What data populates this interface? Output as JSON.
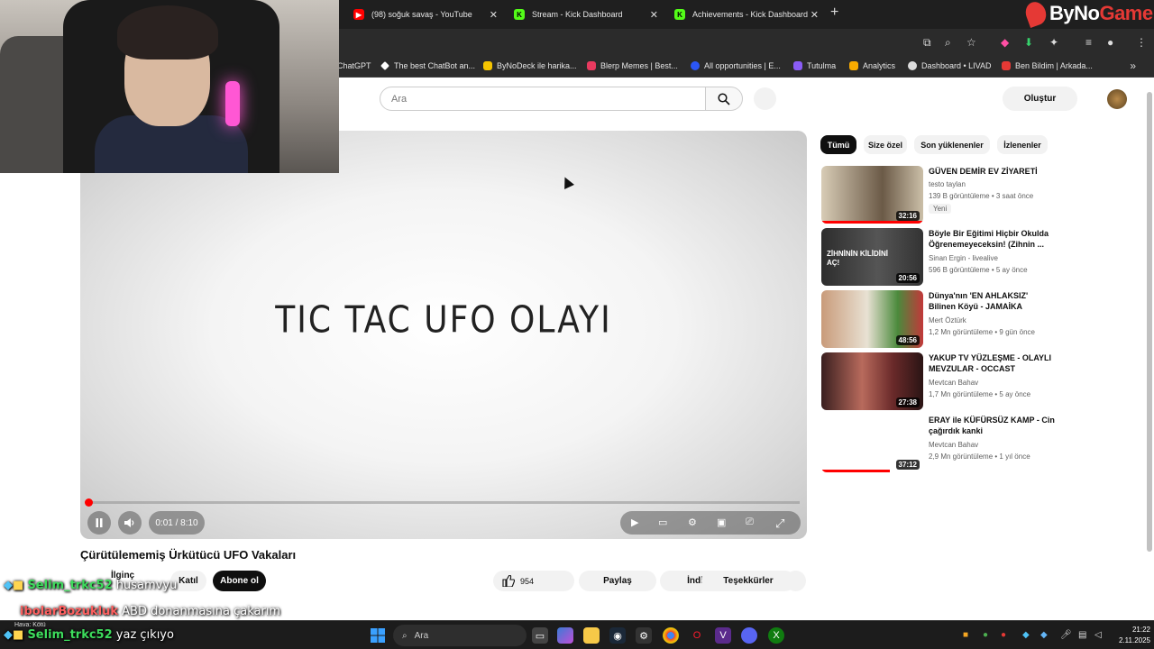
{
  "browser": {
    "tabs": [
      {
        "label": "(98) soğuk savaş - YouTube",
        "color": "#ff0000",
        "glyph": "▶"
      },
      {
        "label": "Stream - Kick Dashboard",
        "color": "#53fc18",
        "glyph": "K"
      },
      {
        "label": "Achievements - Kick Dashboard",
        "color": "#53fc18",
        "glyph": "K"
      }
    ],
    "new_tab": "+",
    "close_glyph": "✕",
    "bookmarks": [
      {
        "label": "ChatGPT",
        "color": "#2b2b2b"
      },
      {
        "label": "The best ChatBot an...",
        "color": "#ffffff"
      },
      {
        "label": "ByNoDeck ile harika...",
        "color": "#f5c400"
      },
      {
        "label": "Blerp Memes | Best...",
        "color": "#e83a5f"
      },
      {
        "label": "All opportunities | E...",
        "color": "#2b56f5"
      },
      {
        "label": "Tutulma",
        "color": "#8a5cf6"
      },
      {
        "label": "Analytics",
        "color": "#f9ab00"
      },
      {
        "label": "Dashboard • LIVAD",
        "color": "#dddddd"
      },
      {
        "label": "Ben Bildim | Arkada...",
        "color": "#e53935"
      }
    ],
    "more_bookmarks": "»"
  },
  "brand": {
    "name_a": "ByNo",
    "name_b": "Game"
  },
  "youtube": {
    "search_placeholder": "Ara",
    "create_label": "Oluştur",
    "video": {
      "overlay_title": "TIC TAC UFO OLAYI",
      "time": "0:01 / 8:10",
      "progress": 0.002,
      "title": "Çürütülememiş Ürkütücü UFO Vakaları",
      "channel": "İlginç",
      "join_label": "Katıl",
      "subscribe_label": "Abone ol",
      "likes": "954",
      "share_label": "Paylaş",
      "download_label": "İndir",
      "thanks_label": "Teşekkürler"
    },
    "chips": [
      "Tümü",
      "Size özel",
      "Son yüklenenler",
      "İzlenenler"
    ],
    "recommendations": [
      {
        "title": "GÜVEN DEMİR EV ZİYARETİ",
        "channel": "testo taylan",
        "meta": "139 B görüntüleme • 3 saat önce",
        "badge": "Yeni",
        "duration": "32:16",
        "thumb_color": "#b9a98f"
      },
      {
        "title": "Böyle Bir Eğitimi Hiçbir Okulda Öğrenemeyeceksin! (Zihnin ...",
        "channel": "Sinan Ergin - livealive",
        "meta": "596 B görüntüleme • 5 ay önce",
        "duration": "20:56",
        "thumb_color": "#3a3a3a",
        "thumb_text": "ZİHNİNİN KİLİDİNİ AÇ!"
      },
      {
        "title": "Dünya'nın 'EN AHLAKSIZ' Bilinen Köyü - JAMAİKA",
        "channel": "Mert Öztürk",
        "meta": "1,2 Mn görüntüleme • 9 gün önce",
        "duration": "48:56",
        "thumb_color": "#7a8a4a"
      },
      {
        "title": "YAKUP TV YÜZLEŞME - OLAYLI MEVZULAR - OCCAST",
        "channel": "Mevtcan Bahav",
        "meta": "1,7 Mn görüntüleme • 5 ay önce",
        "duration": "27:38",
        "thumb_color": "#5a2a2a"
      },
      {
        "title": "ERAY ile KÜFÜRSÜZ KAMP - Cin çağırdık kanki",
        "channel": "Mevtcan Bahav",
        "meta": "2,9 Mn görüntüleme • 1 yıl önce",
        "duration": "37:12",
        "thumb_color": "#ffffff"
      }
    ]
  },
  "chat": [
    {
      "user": "Selim_trkc52",
      "msg": "husamvyu",
      "user_color": "#3ddc5c"
    },
    {
      "user": "ibolarBozukluk",
      "msg": "ABD donanmasına çakarım",
      "user_color": "#ff6060"
    },
    {
      "user": "Selim_trkc52",
      "msg": "yaz çıkıyo",
      "user_color": "#3ddc5c"
    }
  ],
  "taskbar": {
    "search_label": "Ara",
    "weather": "Hava: Kötü",
    "time": "21:22",
    "date": "2.11.2025"
  }
}
